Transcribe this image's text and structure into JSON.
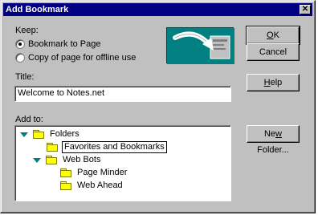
{
  "window": {
    "title": "Add Bookmark",
    "close_glyph": "✕"
  },
  "keep": {
    "label": "Keep:",
    "options": [
      {
        "label": "Bookmark to Page",
        "checked": true
      },
      {
        "label": "Copy of page for offline use",
        "checked": false
      }
    ]
  },
  "title_field": {
    "label": "Title:",
    "value": "Welcome to Notes.net"
  },
  "add_to": {
    "label": "Add to:",
    "tree": [
      {
        "label": "Folders",
        "expanded": true
      },
      {
        "label": "Favorites and Bookmarks",
        "selected": true
      },
      {
        "label": "Web Bots",
        "expanded": true
      },
      {
        "label": "Page Minder"
      },
      {
        "label": "Web Ahead"
      }
    ]
  },
  "buttons": {
    "ok": {
      "pre": "",
      "u": "O",
      "post": "K"
    },
    "cancel": {
      "label": "Cancel"
    },
    "help": {
      "pre": "",
      "u": "H",
      "post": "elp"
    },
    "new_folder": {
      "pre": "Ne",
      "u": "w",
      "post": " Folder..."
    }
  },
  "colors": {
    "title_bar": "#000080",
    "dialog_bg": "#c0c0c0",
    "illustration_bg": "#008080",
    "folder": "#ffff00",
    "tree_arrow": "#007f7f"
  },
  "icons": {
    "illustration": "bookmark-arrow-illustration",
    "folder": "folder-icon",
    "expand": "expanded-triangle-icon"
  }
}
